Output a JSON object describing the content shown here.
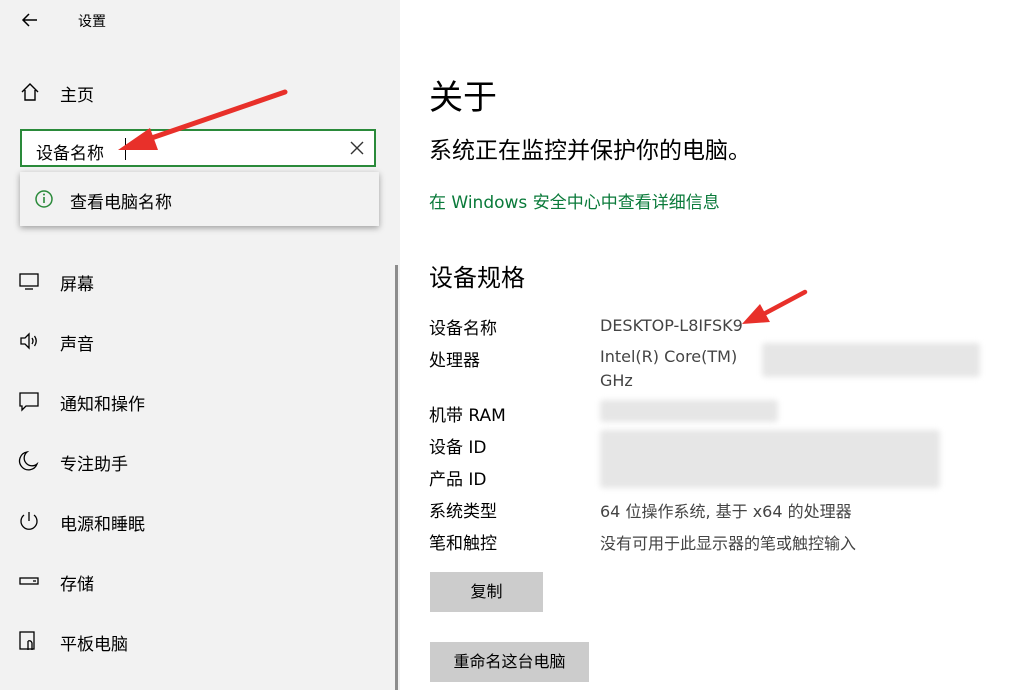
{
  "window": {
    "title": "设置"
  },
  "sidebar": {
    "home_label": "主页",
    "search": {
      "value": "设备名称"
    },
    "suggestion": {
      "label": "查看电脑名称",
      "icon": "info-icon"
    },
    "items": [
      {
        "label": "屏幕",
        "icon": "display-icon"
      },
      {
        "label": "声音",
        "icon": "speaker-icon"
      },
      {
        "label": "通知和操作",
        "icon": "notification-icon"
      },
      {
        "label": "专注助手",
        "icon": "moon-icon"
      },
      {
        "label": "电源和睡眠",
        "icon": "power-icon"
      },
      {
        "label": "存储",
        "icon": "storage-icon"
      },
      {
        "label": "平板电脑",
        "icon": "tablet-icon"
      }
    ]
  },
  "main": {
    "title": "关于",
    "status": "系统正在监控并保护你的电脑。",
    "security_link": "在 Windows 安全中心中查看详细信息",
    "specs_title": "设备规格",
    "specs": [
      {
        "label": "设备名称",
        "value": "DESKTOP-L8IFSK9"
      },
      {
        "label": "处理器",
        "value": "Intel(R) Core(TM)",
        "value2": "GHz"
      },
      {
        "label": "机带 RAM",
        "value": ""
      },
      {
        "label": "设备 ID",
        "value": ""
      },
      {
        "label": "产品 ID",
        "value": ""
      },
      {
        "label": "系统类型",
        "value": "64 位操作系统, 基于 x64 的处理器"
      },
      {
        "label": "笔和触控",
        "value": "没有可用于此显示器的笔或触控输入"
      }
    ],
    "copy_button": "复制",
    "rename_button": "重命名这台电脑"
  },
  "colors": {
    "accent_green": "#0a7a3a",
    "search_border": "#2a8a3a",
    "annotation_arrow": "#e8302a"
  }
}
